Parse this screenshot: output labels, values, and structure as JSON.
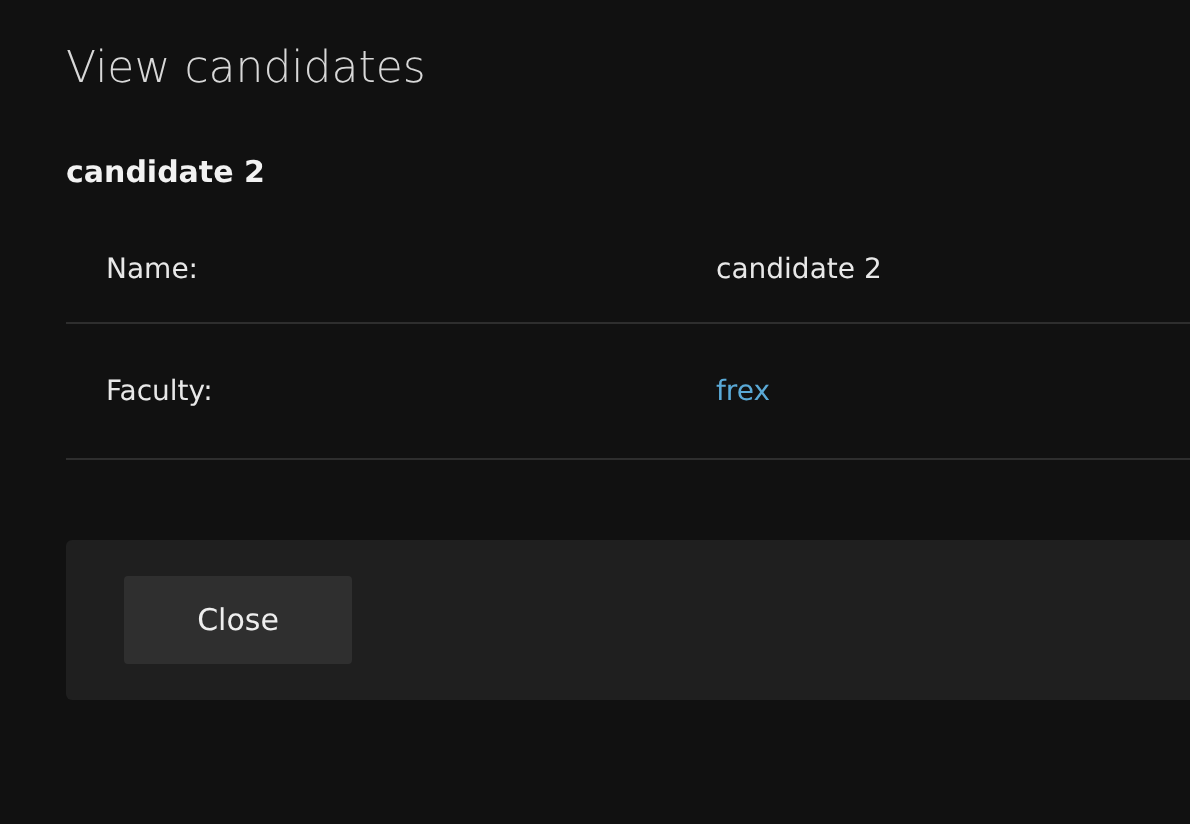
{
  "window": {
    "title": "View candidates"
  },
  "candidate": {
    "heading": "candidate 2",
    "fields": [
      {
        "label": "Name:",
        "value": "candidate 2",
        "kind": "text"
      },
      {
        "label": "Faculty:",
        "value": "frex",
        "kind": "link"
      }
    ]
  },
  "buttons": [
    "Close"
  ]
}
